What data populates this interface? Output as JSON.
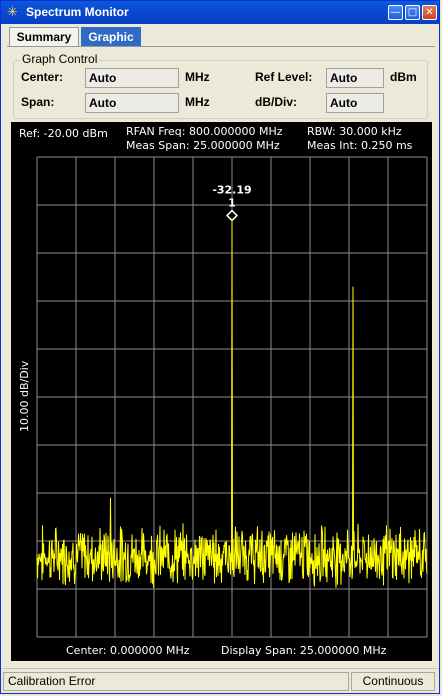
{
  "window": {
    "title": "Spectrum Monitor",
    "icon": "spectrum-icon",
    "buttons": [
      "minimize-icon",
      "maximize-icon",
      "close-icon"
    ]
  },
  "tabs": [
    {
      "label": "Summary",
      "active": false
    },
    {
      "label": "Graphic",
      "active": true
    }
  ],
  "graph_control": {
    "title": "Graph Control",
    "center_label": "Center:",
    "center_value": "Auto",
    "center_unit": "MHz",
    "span_label": "Span:",
    "span_value": "Auto",
    "span_unit": "MHz",
    "ref_level_label": "Ref Level:",
    "ref_level_value": "Auto",
    "ref_level_unit": "dBm",
    "db_div_label": "dB/Div:",
    "db_div_value": "Auto"
  },
  "graph": {
    "ref": "Ref: -20.00 dBm",
    "rfan_freq": "RFAN Freq: 800.000000 MHz",
    "meas_span": "Meas Span: 25.000000 MHz",
    "rbw": "RBW: 30.000 kHz",
    "meas_int": "Meas Int: 0.250 ms",
    "y_axis_label": "10.00 dB/Div",
    "center": "Center: 0.000000 MHz",
    "display_span": "Display Span: 25.000000 MHz",
    "marker_value": "-32.19",
    "marker_number": "1",
    "trace_color": "#ffff00",
    "grid_color": "#8c8c8c"
  },
  "chart_data": {
    "type": "line",
    "title": "",
    "xlabel": "",
    "ylabel": "10.00 dB/Div",
    "x_center_mhz": 0,
    "x_span_mhz": 25,
    "xlim": [
      -12.5,
      12.5
    ],
    "ylim": [
      -120,
      -20
    ],
    "grid": true,
    "series": [
      {
        "color": "#ffff00",
        "noise_floor_dbm": -103,
        "peaks": [
          {
            "x": 0.0,
            "y": -32.19
          },
          {
            "x": 7.75,
            "y": -47
          },
          {
            "x": -7.8,
            "y": -91
          },
          {
            "x": 0.0,
            "y": -86
          },
          {
            "x": 7.75,
            "y": -92
          }
        ]
      }
    ],
    "markers": [
      {
        "number": "1",
        "x": 0.0,
        "y": -32.19
      }
    ]
  },
  "status": {
    "left": "Calibration Error",
    "right": "Continuous"
  }
}
